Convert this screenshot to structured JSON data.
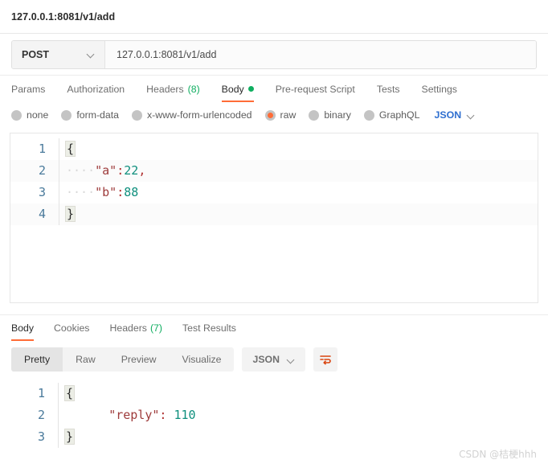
{
  "titlebar": {
    "tab_title": "127.0.0.1:8081/v1/add"
  },
  "request": {
    "method": "POST",
    "url": "127.0.0.1:8081/v1/add",
    "tabs": [
      {
        "label": "Params",
        "active": false
      },
      {
        "label": "Authorization",
        "active": false
      },
      {
        "label": "Headers",
        "count": "(8)",
        "active": false
      },
      {
        "label": "Body",
        "active": true,
        "dot": "green"
      },
      {
        "label": "Pre-request Script",
        "active": false
      },
      {
        "label": "Tests",
        "active": false
      },
      {
        "label": "Settings",
        "active": false
      }
    ],
    "body_types": [
      {
        "label": "none",
        "selected": false
      },
      {
        "label": "form-data",
        "selected": false
      },
      {
        "label": "x-www-form-urlencoded",
        "selected": false
      },
      {
        "label": "raw",
        "selected": true
      },
      {
        "label": "binary",
        "selected": false
      },
      {
        "label": "GraphQL",
        "selected": false
      }
    ],
    "format_label": "JSON",
    "body_lines": [
      {
        "n": "1",
        "open_brace": "{",
        "indent": "",
        "key": "",
        "colon": "",
        "value": "",
        "comma": ""
      },
      {
        "n": "2",
        "open_brace": "",
        "indent": "····",
        "key": "\"a\"",
        "colon": ":",
        "value": "22",
        "comma": ","
      },
      {
        "n": "3",
        "open_brace": "",
        "indent": "····",
        "key": "\"b\"",
        "colon": ":",
        "value": "88",
        "comma": ""
      },
      {
        "n": "4",
        "open_brace": "}",
        "indent": "",
        "key": "",
        "colon": "",
        "value": "",
        "comma": ""
      }
    ]
  },
  "response": {
    "tabs": [
      {
        "label": "Body",
        "active": true
      },
      {
        "label": "Cookies",
        "active": false
      },
      {
        "label": "Headers",
        "count": "(7)",
        "active": false
      },
      {
        "label": "Test Results",
        "active": false
      }
    ],
    "view_modes": [
      {
        "label": "Pretty",
        "active": true
      },
      {
        "label": "Raw",
        "active": false
      },
      {
        "label": "Preview",
        "active": false
      },
      {
        "label": "Visualize",
        "active": false
      }
    ],
    "format_label": "JSON",
    "wrap_icon": "wrap-lines-icon",
    "body_lines": [
      {
        "n": "1",
        "open_brace": "{",
        "indent": "",
        "key": "",
        "colon": "",
        "value": ""
      },
      {
        "n": "2",
        "open_brace": "",
        "indent": "      ",
        "key": "\"reply\"",
        "colon": ":",
        "value": " 110"
      },
      {
        "n": "3",
        "open_brace": "}",
        "indent": "",
        "key": "",
        "colon": "",
        "value": ""
      }
    ]
  },
  "watermark": {
    "text": "CSDN @桔梗hhh"
  },
  "colors": {
    "accent_orange": "#ff6c37",
    "status_green": "#0fae60",
    "link_blue": "#2f6fd0",
    "json_key": "#9e3b3b",
    "json_number": "#0e8f7d"
  }
}
